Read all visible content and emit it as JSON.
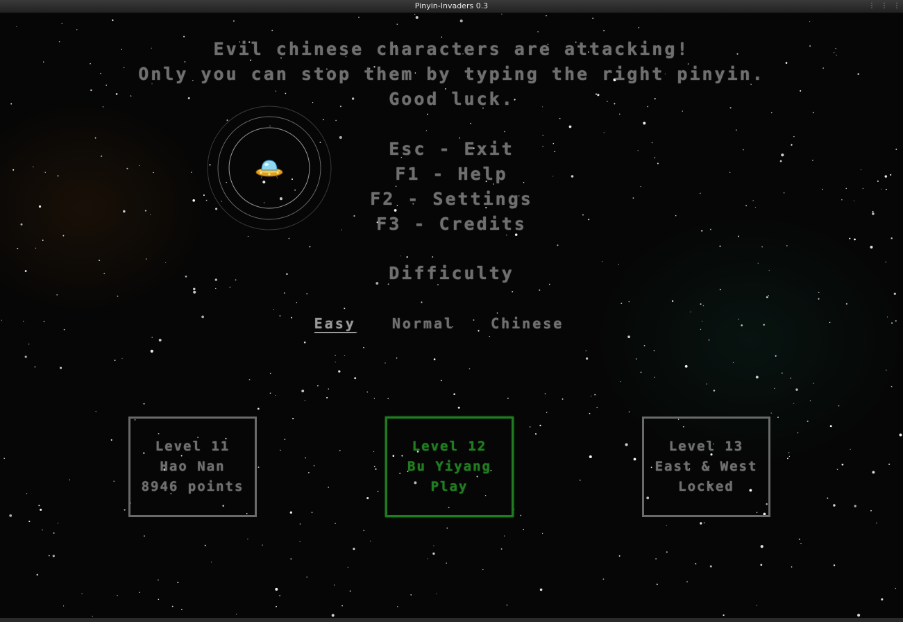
{
  "window": {
    "title": "Pinyin-Invaders 0.3",
    "controls": [
      "⋮",
      "⋮",
      "⋮"
    ]
  },
  "intro": {
    "lines": [
      "Evil chinese characters are attacking!",
      "Only you can stop them by typing the right pinyin.",
      "Good luck."
    ]
  },
  "menu": {
    "items": [
      "Esc - Exit",
      "F1 - Help",
      "F2 - Settings",
      "F3 - Credits"
    ]
  },
  "difficulty": {
    "title": "Difficulty",
    "options": [
      "Easy",
      "Normal",
      "Chinese"
    ],
    "selected": "Easy"
  },
  "levels": [
    {
      "title": "Level 11",
      "name": "Hao Nan",
      "status": "8946 points"
    },
    {
      "title": "Level 12",
      "name": "Bu Yiyang",
      "status": "Play"
    },
    {
      "title": "Level 13",
      "name": "East & West",
      "status": "Locked"
    }
  ],
  "colors": {
    "text": "#6f6f6f",
    "active_level": "#1f7d1f",
    "background": "#060606"
  },
  "icons": {
    "player_ship": "ufo-icon",
    "radar": "radar-rings"
  }
}
